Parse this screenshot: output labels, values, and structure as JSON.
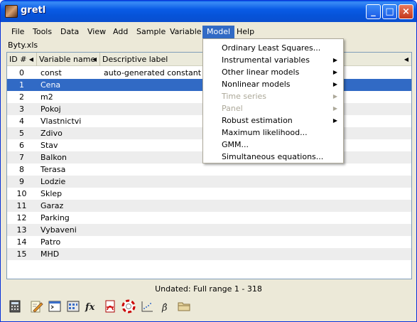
{
  "window": {
    "title": "gretl",
    "icon": "gretl-app-icon"
  },
  "title_buttons": {
    "minimize": "_",
    "maximize": "□",
    "close": "×"
  },
  "menubar": {
    "file": "File",
    "tools": "Tools",
    "data": "Data",
    "view": "View",
    "add": "Add",
    "sample": "Sample",
    "variable": "Variable",
    "model": "Model",
    "help": "Help"
  },
  "dataset": {
    "filename": "Byty.xls"
  },
  "columns": {
    "id": "ID #",
    "name": "Variable name",
    "label": "Descriptive label",
    "sort_arrow": "◀"
  },
  "variables": [
    {
      "id": "0",
      "name": "const",
      "label": "auto-generated constant"
    },
    {
      "id": "1",
      "name": "Cena",
      "label": ""
    },
    {
      "id": "2",
      "name": "m2",
      "label": ""
    },
    {
      "id": "3",
      "name": "Pokoj",
      "label": ""
    },
    {
      "id": "4",
      "name": "Vlastnictvi",
      "label": ""
    },
    {
      "id": "5",
      "name": "Zdivo",
      "label": ""
    },
    {
      "id": "6",
      "name": "Stav",
      "label": ""
    },
    {
      "id": "7",
      "name": "Balkon",
      "label": ""
    },
    {
      "id": "8",
      "name": "Terasa",
      "label": ""
    },
    {
      "id": "9",
      "name": "Lodzie",
      "label": ""
    },
    {
      "id": "10",
      "name": "Sklep",
      "label": ""
    },
    {
      "id": "11",
      "name": "Garaz",
      "label": ""
    },
    {
      "id": "12",
      "name": "Parking",
      "label": ""
    },
    {
      "id": "13",
      "name": "Vybaveni",
      "label": ""
    },
    {
      "id": "14",
      "name": "Patro",
      "label": ""
    },
    {
      "id": "15",
      "name": "MHD",
      "label": ""
    }
  ],
  "selected_variable": "1",
  "status": {
    "text": "Undated: Full range 1 - 318"
  },
  "model_menu": {
    "submenu_arrow": "▶",
    "items": [
      {
        "label": "Ordinary Least Squares...",
        "enabled": true,
        "submenu": false
      },
      {
        "label": "Instrumental variables",
        "enabled": true,
        "submenu": true
      },
      {
        "label": "Other linear models",
        "enabled": true,
        "submenu": true
      },
      {
        "label": "Nonlinear models",
        "enabled": true,
        "submenu": true
      },
      {
        "label": "Time series",
        "enabled": false,
        "submenu": true
      },
      {
        "label": "Panel",
        "enabled": false,
        "submenu": true
      },
      {
        "label": "Robust estimation",
        "enabled": true,
        "submenu": true
      },
      {
        "label": "Maximum likelihood...",
        "enabled": true,
        "submenu": false
      },
      {
        "label": "GMM...",
        "enabled": true,
        "submenu": false
      },
      {
        "label": "Simultaneous equations...",
        "enabled": true,
        "submenu": false
      }
    ]
  },
  "toolbar_icons": [
    "calculator-icon",
    "script-editor-icon",
    "console-icon",
    "session-icons-icon",
    "function-packages-icon",
    "pdf-manual-icon",
    "help-lifebuoy-icon",
    "graph-icon",
    "beta-model-icon",
    "open-folder-icon"
  ],
  "toolbar_glyphs": {
    "fx": "fx",
    "beta": "β̂"
  },
  "colors": {
    "selection": "#316ac5",
    "titlebar": "#0a5ce6",
    "row_alt": "#ededed"
  }
}
